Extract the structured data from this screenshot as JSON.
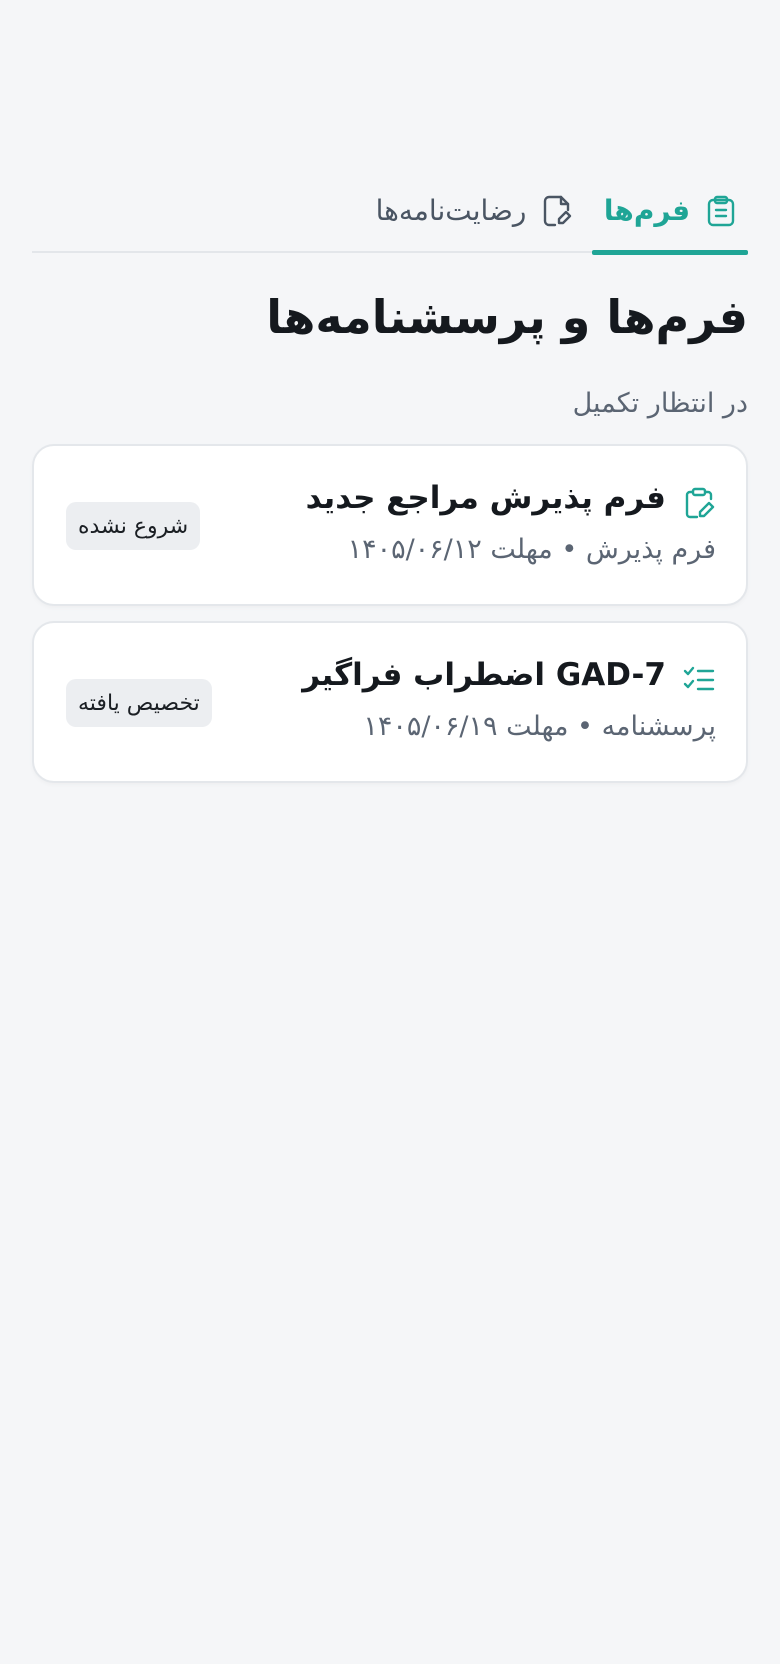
{
  "tabs": [
    {
      "label": "فرم‌ها",
      "icon": "clipboard-icon",
      "active": true
    },
    {
      "label": "رضایت‌نامه‌ها",
      "icon": "document-edit-icon",
      "active": false
    }
  ],
  "page_title": "فرم‌ها و پرسشنامه‌ها",
  "section_label": "در انتظار تکمیل",
  "items": [
    {
      "title": "فرم پذیرش مراجع جدید",
      "icon": "clipboard-edit-icon",
      "meta": "فرم پذیرش • مهلت ۱۴۰۵/۰۶/۱۲",
      "status": "شروع نشده"
    },
    {
      "title": "GAD-7 اضطراب فراگیر",
      "icon": "checklist-icon",
      "meta": "پرسشنامه • مهلت ۱۴۰۵/۰۶/۱۹",
      "status": "تخصیص یافته"
    }
  ],
  "colors": {
    "accent": "#1fa596",
    "background": "#f5f6f8"
  }
}
